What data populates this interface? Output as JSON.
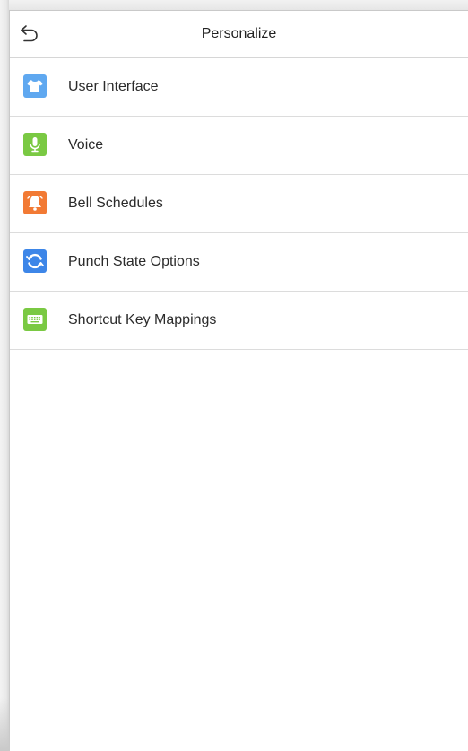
{
  "header": {
    "title": "Personalize"
  },
  "menu": {
    "items": [
      {
        "label": "User Interface",
        "icon": "shirt-icon",
        "color": "#5fa8f0"
      },
      {
        "label": "Voice",
        "icon": "microphone-icon",
        "color": "#7ac943"
      },
      {
        "label": "Bell Schedules",
        "icon": "bell-icon",
        "color": "#f27a34"
      },
      {
        "label": "Punch State Options",
        "icon": "punch-state-icon",
        "color": "#3d86e8"
      },
      {
        "label": "Shortcut Key Mappings",
        "icon": "keyboard-icon",
        "color": "#7ac943"
      }
    ]
  }
}
